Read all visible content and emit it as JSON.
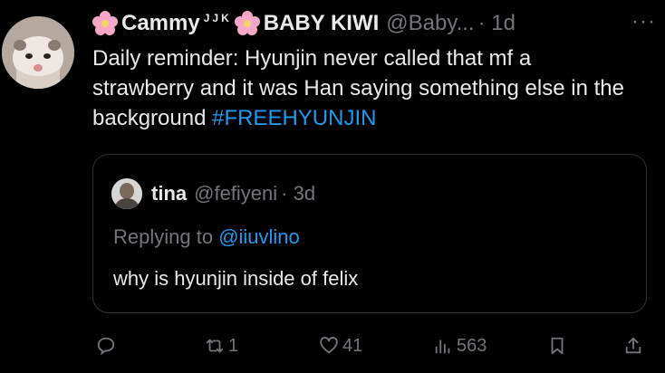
{
  "tweet": {
    "display_name": "Cammy",
    "name_superscript": "JJK",
    "name_suffix": "BABY KIWI",
    "handle": "@Baby...",
    "time": "· 1d",
    "more": "···",
    "text_plain": "Daily reminder: Hyunjin never called that mf a strawberry and it was Han saying something else in the background ",
    "hashtag": "#FREEHYUNJIN"
  },
  "quote": {
    "name": "tina",
    "handle": "@fefiyeni",
    "time": "· 3d",
    "replying_prefix": "Replying to ",
    "replying_mention": "@iiuvlino",
    "text": "why is hyunjin inside of felix"
  },
  "actions": {
    "reply_icon": "reply-icon",
    "retweet_count": "1",
    "like_count": "41",
    "views_count": "563",
    "bookmark_icon": "bookmark-icon",
    "share_icon": "share-icon"
  },
  "colors": {
    "background": "#000000",
    "text": "#e7e9ea",
    "secondary": "#71767b",
    "link": "#1d9bf0",
    "border": "#2f3336",
    "flower": "#f7a8c8"
  }
}
